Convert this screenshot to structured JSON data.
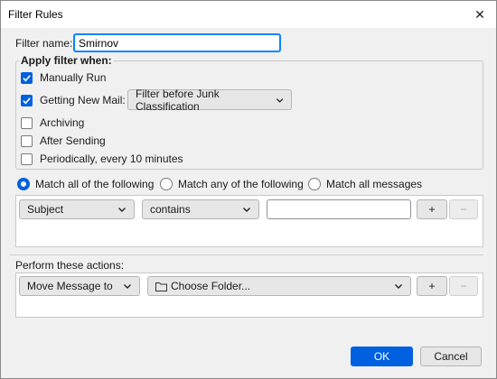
{
  "window": {
    "title": "Filter Rules",
    "close_symbol": "✕"
  },
  "filter": {
    "name_label": "Filter name:",
    "name_value": "Smirnov"
  },
  "apply": {
    "legend": "Apply filter when:",
    "options": [
      {
        "label": "Manually Run",
        "checked": true
      },
      {
        "label": "Getting New Mail:",
        "checked": true
      },
      {
        "label": "Archiving",
        "checked": false
      },
      {
        "label": "After Sending",
        "checked": false
      },
      {
        "label": "Periodically, every 10 minutes",
        "checked": false
      }
    ],
    "junk_dropdown": "Filter before Junk Classification"
  },
  "match": {
    "options": [
      {
        "label": "Match all of the following",
        "selected": true
      },
      {
        "label": "Match any of the following",
        "selected": false
      },
      {
        "label": "Match all messages",
        "selected": false
      }
    ]
  },
  "rule": {
    "field": "Subject",
    "operator": "contains",
    "value": "",
    "add": "+",
    "remove": "−"
  },
  "actions": {
    "label": "Perform these actions:",
    "action": "Move Message to",
    "folder": "Choose Folder...",
    "add": "+",
    "remove": "−"
  },
  "footer": {
    "ok": "OK",
    "cancel": "Cancel"
  }
}
